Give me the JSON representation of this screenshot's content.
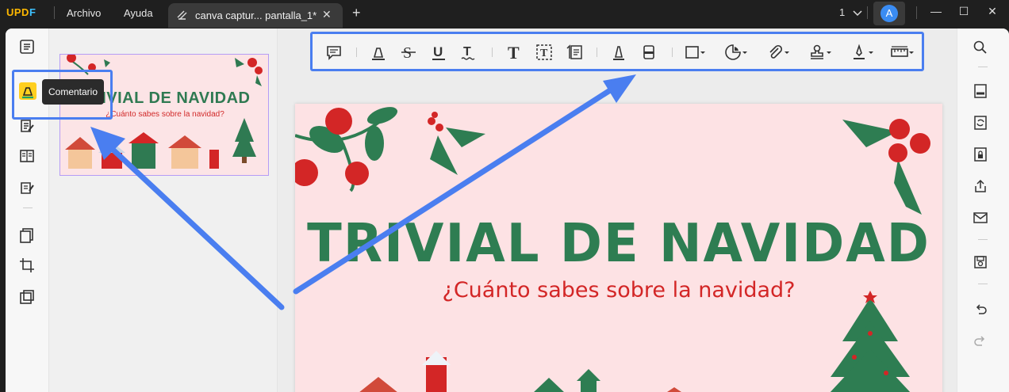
{
  "app": {
    "logo_u": "UPD",
    "logo_f": "F",
    "menu": {
      "file": "Archivo",
      "help": "Ayuda"
    },
    "tab": {
      "title": "canva captur... pantalla_1*",
      "close": "✕"
    },
    "new_tab": "+",
    "page_selector": "1",
    "avatar_initial": "A",
    "window": {
      "minimize": "—",
      "maximize": "☐",
      "close": "✕"
    }
  },
  "tooltip": {
    "text": "Comentario"
  },
  "document": {
    "title": "TRIVIAL DE NAVIDAD",
    "subtitle": "¿Cuánto sabes sobre la navidad?"
  },
  "colors": {
    "accent_highlight": "#4a7ef0",
    "page_background": "#fde2e4",
    "title_green": "#2e7d52",
    "subtitle_red": "#d32626"
  },
  "toolbar_tools": [
    "comment-icon",
    "highlight-icon",
    "strikethrough-icon",
    "underline-icon",
    "squiggly-icon",
    "text-icon",
    "textbox-icon",
    "text-callout-icon",
    "pencil-icon",
    "eraser-icon",
    "shape-icon",
    "sticker-icon",
    "attachment-icon",
    "stamp-icon",
    "signature-icon",
    "measure-icon"
  ]
}
